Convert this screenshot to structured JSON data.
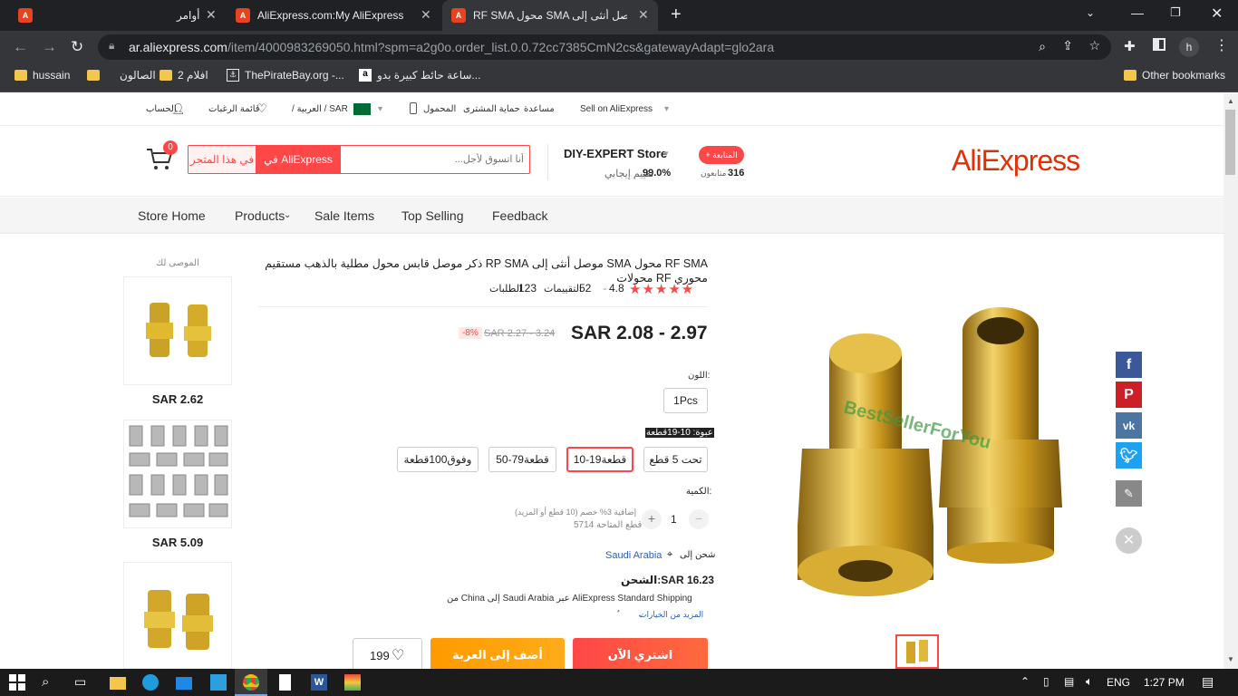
{
  "browser": {
    "tabs": [
      {
        "label": "أوامر"
      },
      {
        "label": "AliExpress.com:My AliExpress"
      },
      {
        "label": "RF SMA محول SMA موصل أنثى إلى"
      }
    ],
    "url_host": "ar.aliexpress.com",
    "url_path": "/item/4000983269050.html?spm=a2g0o.order_list.0.0.72cc7385CmN2cs&gatewayAdapt=glo2ara",
    "profile_initial": "h",
    "bookmarks": [
      {
        "label": "hussain"
      },
      {
        "label": "الصالون"
      },
      {
        "label": "افلام 2"
      },
      {
        "label": "ThePirateBay.org -..."
      },
      {
        "label": "ساعة حائط كبيرة بدو..."
      }
    ],
    "other_bookmarks": "Other bookmarks"
  },
  "topnav": {
    "sell": "Sell on AliExpress",
    "help": "مساعدة",
    "buyer_protection": "حماية المشترى",
    "app": "المحمول",
    "lang_currency": "/ العربية / SAR",
    "wishlist": "قائمة الرغبات",
    "account": "الحساب"
  },
  "header": {
    "logo": "AliExpress",
    "follow_btn": "+ المتابعة",
    "followers_count": "316",
    "followers_label": "متابعون",
    "store_name": "DIY-EXPERT Store",
    "rating_value": "99.0%",
    "rating_label": "تقييم إيجابي",
    "search_placeholder": "أنا اتسوق لأجل...",
    "search_aliexpress": "في AliExpress",
    "search_store": "في هذا المتجر",
    "cart_count": "0"
  },
  "subnav": [
    "Store Home",
    "Products",
    "Sale Items",
    "Top Selling",
    "Feedback"
  ],
  "recommend": {
    "title": "الموصى لك",
    "prices": [
      "SAR 2.62",
      "SAR 5.09"
    ]
  },
  "product": {
    "title": "RF SMA محول SMA موصل أنثى إلى RP SMA ذكر موصل قابس محول مطلية بالذهب مستقيم محوري RF محولات",
    "rating": "4.8",
    "reviews_count": "52",
    "reviews_label": "التقييمات",
    "orders_count": "123",
    "orders_label": "الطلبات",
    "price": "SAR 2.08 - 2.97",
    "old_price": "SAR 2.27 - 3.24",
    "discount": "-8%",
    "color_label": "اللون:",
    "color_value": "1Pcs",
    "bundle_label": "عبوة: 10-19قطعة",
    "bundles": [
      "تحت 5 قطع",
      "10-19قطعة",
      "50-79قطعة",
      "وفوق100قطعة"
    ],
    "qty_label": "الكمية:",
    "qty_value": "1",
    "qty_note": "إضافية 3% خصم (10 قطع أو المزيد)",
    "stock": "5714 قطع المتاحة",
    "ship_to_label": "شحن إلى",
    "ship_to": "Saudi Arabia",
    "shipping": "الشحن:SAR 16.23",
    "shipping_detail": "من China إلى Saudi Arabia عبر AliExpress Standard Shipping",
    "more_options": "المزيد من الخيارات",
    "delivery_prefix": "ٌ",
    "buy_now": "اشتري الآن",
    "add_cart": "أضف إلى العربة",
    "wish_count": "199",
    "watermark": "BestSellerForYou"
  },
  "taskbar": {
    "lang": "ENG",
    "time": "1:27 PM"
  },
  "colors": {
    "accent": "#ff4747",
    "ali_red": "#e62e04",
    "orange": "#ff9900",
    "facebook": "#3b5998",
    "pinterest": "#cb2027",
    "vk": "#4c75a3",
    "twitter": "#1da1f2"
  }
}
